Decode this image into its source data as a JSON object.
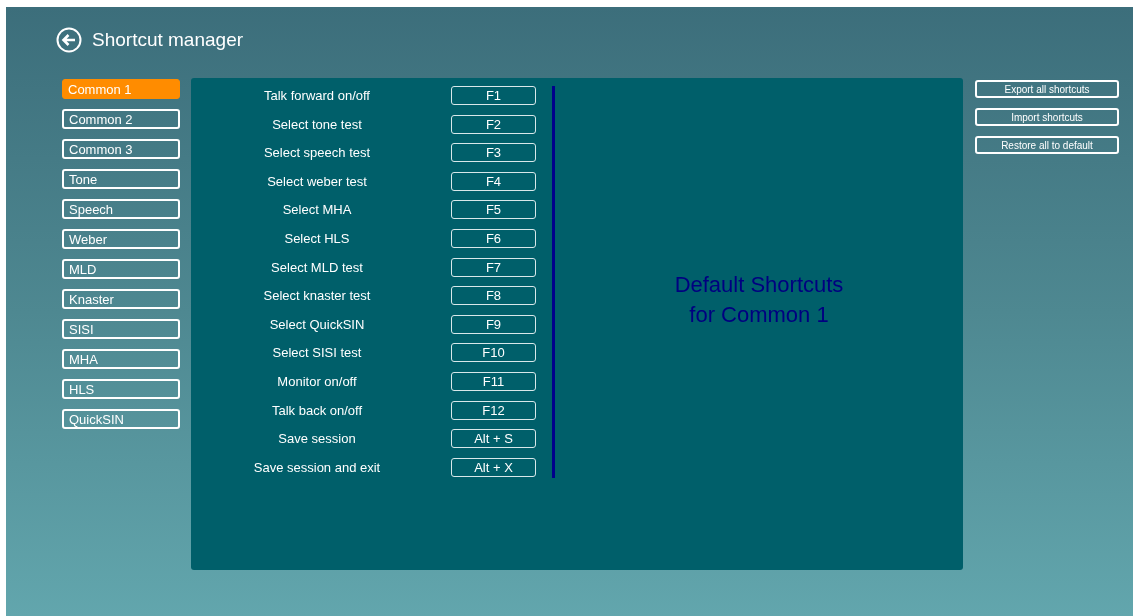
{
  "header": {
    "title": "Shortcut manager"
  },
  "categories": [
    {
      "label": "Common 1",
      "selected": true
    },
    {
      "label": "Common 2",
      "selected": false
    },
    {
      "label": "Common 3",
      "selected": false
    },
    {
      "label": "Tone",
      "selected": false
    },
    {
      "label": "Speech",
      "selected": false
    },
    {
      "label": "Weber",
      "selected": false
    },
    {
      "label": "MLD",
      "selected": false
    },
    {
      "label": "Knaster",
      "selected": false
    },
    {
      "label": "SISI",
      "selected": false
    },
    {
      "label": "MHA",
      "selected": false
    },
    {
      "label": "HLS",
      "selected": false
    },
    {
      "label": "QuickSIN",
      "selected": false
    }
  ],
  "shortcuts": [
    {
      "action": "Talk forward on/off",
      "key": "F1"
    },
    {
      "action": "Select tone test",
      "key": "F2"
    },
    {
      "action": "Select speech test",
      "key": "F3"
    },
    {
      "action": "Select weber test",
      "key": "F4"
    },
    {
      "action": "Select MHA",
      "key": "F5"
    },
    {
      "action": "Select HLS",
      "key": "F6"
    },
    {
      "action": "Select MLD test",
      "key": "F7"
    },
    {
      "action": "Select knaster test",
      "key": "F8"
    },
    {
      "action": "Select QuickSIN",
      "key": "F9"
    },
    {
      "action": "Select SISI test",
      "key": "F10"
    },
    {
      "action": "Monitor on/off",
      "key": "F11"
    },
    {
      "action": "Talk back on/off",
      "key": "F12"
    },
    {
      "action": "Save session",
      "key": "Alt + S"
    },
    {
      "action": "Save session and exit",
      "key": "Alt + X"
    }
  ],
  "info": [
    "Default Shortcuts",
    "for Common 1"
  ],
  "actions": [
    "Export all shortcuts",
    "Import shortcuts",
    "Restore all to default"
  ]
}
